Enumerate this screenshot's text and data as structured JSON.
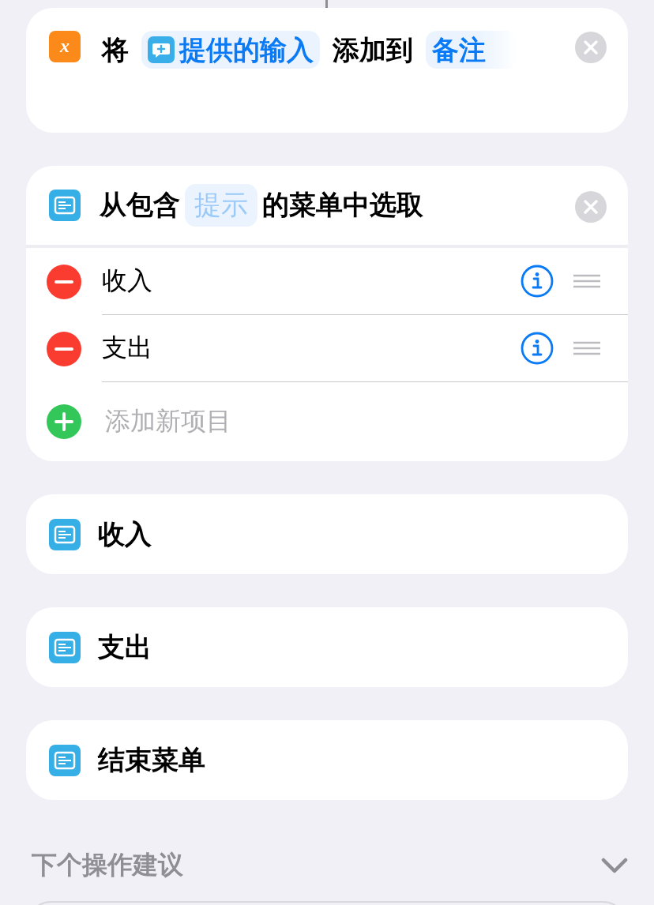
{
  "add_action": {
    "icon_glyph": "x",
    "verb": "将",
    "input_token": "提供的输入",
    "preposition": "添加到",
    "target_token": "备注"
  },
  "menu_action": {
    "prefix": "从包含",
    "prompt_placeholder": "提示",
    "suffix": "的菜单中选取",
    "items": [
      {
        "label": "收入"
      },
      {
        "label": "支出"
      }
    ],
    "add_item_label": "添加新项目"
  },
  "menu_cases": [
    {
      "label": "收入"
    },
    {
      "label": "支出"
    },
    {
      "label": "结束菜单"
    }
  ],
  "suggestions": {
    "title": "下个操作建议"
  }
}
